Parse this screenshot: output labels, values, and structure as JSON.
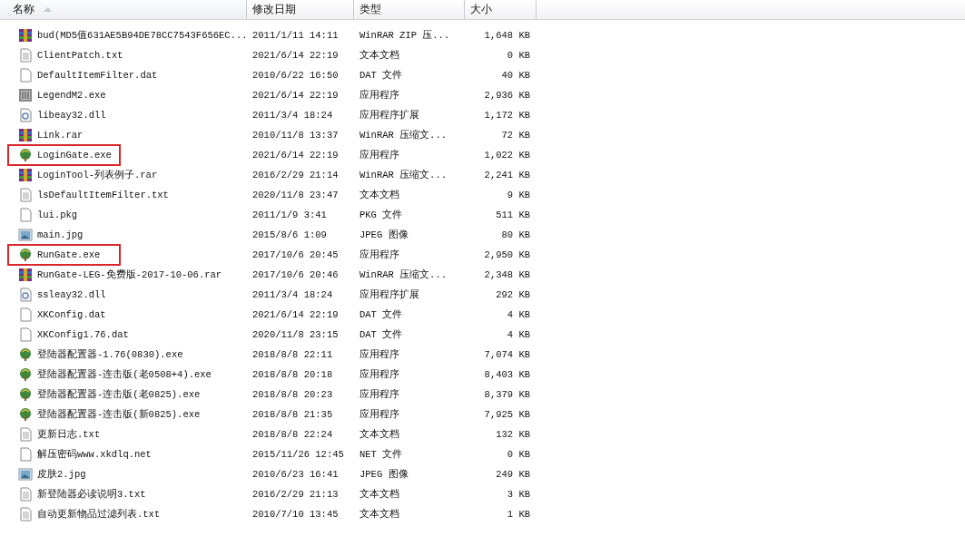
{
  "columns": [
    {
      "label": "名称",
      "sorted": true
    },
    {
      "label": "修改日期",
      "sorted": false
    },
    {
      "label": "类型",
      "sorted": false
    },
    {
      "label": "大小",
      "sorted": false
    }
  ],
  "files": [
    {
      "kind": "rar",
      "name": "bud(MD5值631AE5B94DE78CC7543F656EC...",
      "date": "2011/1/11 14:11",
      "type": "WinRAR ZIP 压...",
      "size": "1,648 KB",
      "highlighted": false
    },
    {
      "kind": "txt",
      "name": "ClientPatch.txt",
      "date": "2021/6/14 22:19",
      "type": "文本文档",
      "size": "0 KB",
      "highlighted": false
    },
    {
      "kind": "file",
      "name": "DefaultItemFilter.dat",
      "date": "2010/6/22 16:50",
      "type": "DAT 文件",
      "size": "40 KB",
      "highlighted": false
    },
    {
      "kind": "app",
      "name": "LegendM2.exe",
      "date": "2021/6/14 22:19",
      "type": "应用程序",
      "size": "2,936 KB",
      "highlighted": false
    },
    {
      "kind": "dll",
      "name": "libeay32.dll",
      "date": "2011/3/4 18:24",
      "type": "应用程序扩展",
      "size": "1,172 KB",
      "highlighted": false
    },
    {
      "kind": "rar",
      "name": "Link.rar",
      "date": "2010/11/8 13:37",
      "type": "WinRAR 压缩文...",
      "size": "72 KB",
      "highlighted": false
    },
    {
      "kind": "exe",
      "name": "LoginGate.exe",
      "date": "2021/6/14 22:19",
      "type": "应用程序",
      "size": "1,022 KB",
      "highlighted": true
    },
    {
      "kind": "rar",
      "name": "LoginTool-列表例子.rar",
      "date": "2016/2/29 21:14",
      "type": "WinRAR 压缩文...",
      "size": "2,241 KB",
      "highlighted": false
    },
    {
      "kind": "txt",
      "name": "lsDefaultItemFilter.txt",
      "date": "2020/11/8 23:47",
      "type": "文本文档",
      "size": "9 KB",
      "highlighted": false
    },
    {
      "kind": "file",
      "name": "lui.pkg",
      "date": "2011/1/9 3:41",
      "type": "PKG 文件",
      "size": "511 KB",
      "highlighted": false
    },
    {
      "kind": "jpg",
      "name": "main.jpg",
      "date": "2015/8/6 1:09",
      "type": "JPEG 图像",
      "size": "80 KB",
      "highlighted": false
    },
    {
      "kind": "exe",
      "name": "RunGate.exe",
      "date": "2017/10/6 20:45",
      "type": "应用程序",
      "size": "2,950 KB",
      "highlighted": true
    },
    {
      "kind": "rar",
      "name": "RunGate-LEG-免费版-2017-10-06.rar",
      "date": "2017/10/6 20:46",
      "type": "WinRAR 压缩文...",
      "size": "2,348 KB",
      "highlighted": false
    },
    {
      "kind": "dll",
      "name": "ssleay32.dll",
      "date": "2011/3/4 18:24",
      "type": "应用程序扩展",
      "size": "292 KB",
      "highlighted": false
    },
    {
      "kind": "file",
      "name": "XKConfig.dat",
      "date": "2021/6/14 22:19",
      "type": "DAT 文件",
      "size": "4 KB",
      "highlighted": false
    },
    {
      "kind": "file",
      "name": "XKConfig1.76.dat",
      "date": "2020/11/8 23:15",
      "type": "DAT 文件",
      "size": "4 KB",
      "highlighted": false
    },
    {
      "kind": "exe",
      "name": "登陆器配置器-1.76(0830).exe",
      "date": "2018/8/8 22:11",
      "type": "应用程序",
      "size": "7,074 KB",
      "highlighted": false
    },
    {
      "kind": "exe",
      "name": "登陆器配置器-连击版(老0508+4).exe",
      "date": "2018/8/8 20:18",
      "type": "应用程序",
      "size": "8,403 KB",
      "highlighted": false
    },
    {
      "kind": "exe",
      "name": "登陆器配置器-连击版(老0825).exe",
      "date": "2018/8/8 20:23",
      "type": "应用程序",
      "size": "8,379 KB",
      "highlighted": false
    },
    {
      "kind": "exe",
      "name": "登陆器配置器-连击版(新0825).exe",
      "date": "2018/8/8 21:35",
      "type": "应用程序",
      "size": "7,925 KB",
      "highlighted": false
    },
    {
      "kind": "txt",
      "name": "更新日志.txt",
      "date": "2018/8/8 22:24",
      "type": "文本文档",
      "size": "132 KB",
      "highlighted": false
    },
    {
      "kind": "file",
      "name": "解压密码www.xkdlq.net",
      "date": "2015/11/26 12:45",
      "type": "NET 文件",
      "size": "0 KB",
      "highlighted": false
    },
    {
      "kind": "jpg",
      "name": "皮肤2.jpg",
      "date": "2010/6/23 16:41",
      "type": "JPEG 图像",
      "size": "249 KB",
      "highlighted": false
    },
    {
      "kind": "txt",
      "name": "新登陆器必读说明3.txt",
      "date": "2016/2/29 21:13",
      "type": "文本文档",
      "size": "3 KB",
      "highlighted": false
    },
    {
      "kind": "txt",
      "name": "自动更新物品过滤列表.txt",
      "date": "2010/7/10 13:45",
      "type": "文本文档",
      "size": "1 KB",
      "highlighted": false
    }
  ]
}
